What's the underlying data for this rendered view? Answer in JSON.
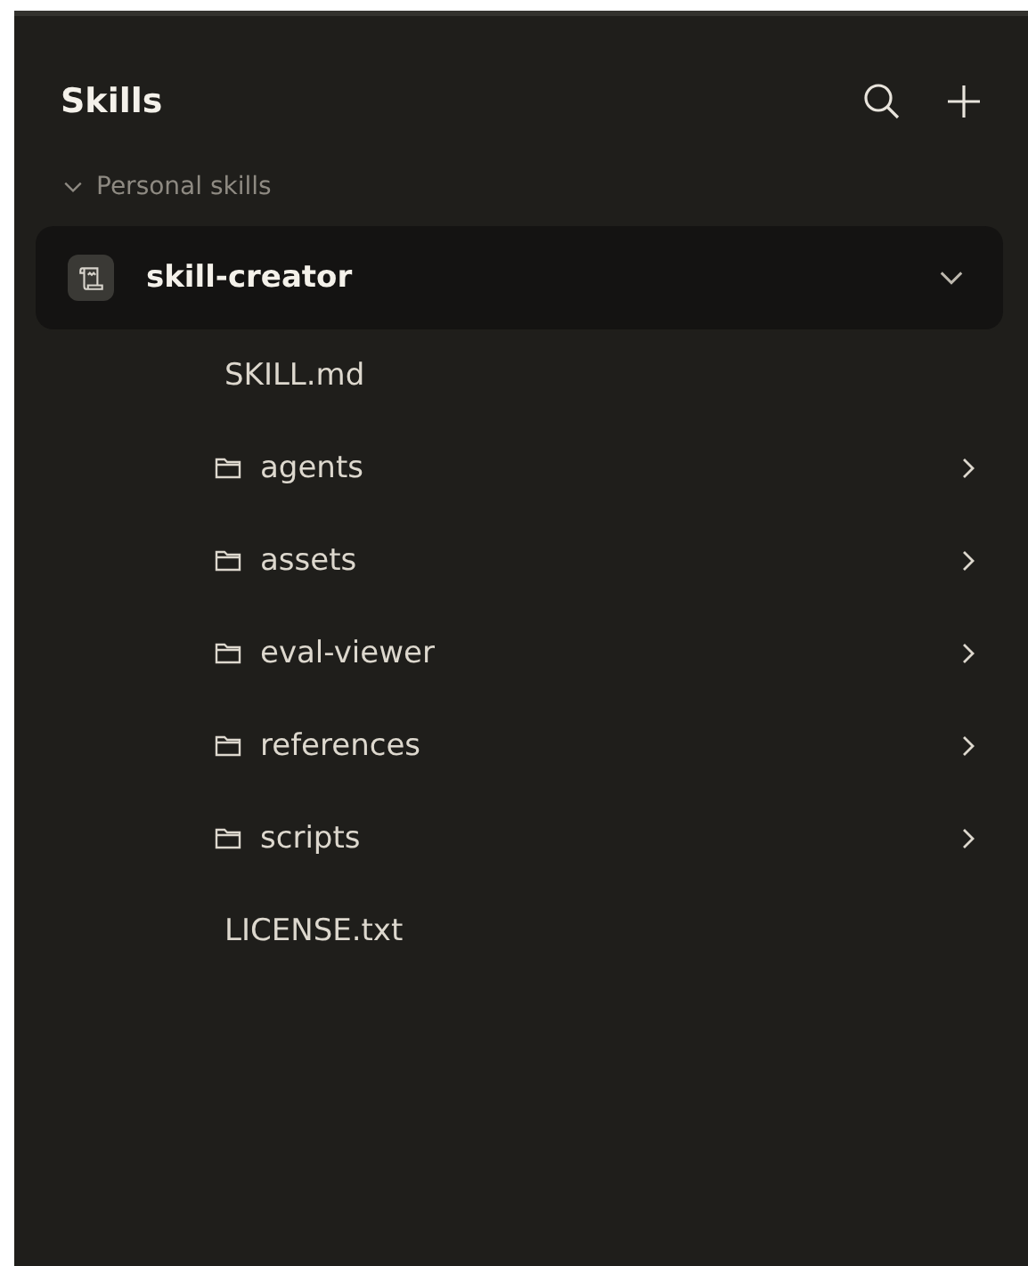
{
  "header": {
    "title": "Skills"
  },
  "section": {
    "label": "Personal skills",
    "expanded": true
  },
  "skills": [
    {
      "name": "skill-creator",
      "selected": true,
      "expanded": true,
      "children": [
        {
          "kind": "file",
          "name": "SKILL.md"
        },
        {
          "kind": "folder",
          "name": "agents",
          "expanded": false
        },
        {
          "kind": "folder",
          "name": "assets",
          "expanded": false
        },
        {
          "kind": "folder",
          "name": "eval-viewer",
          "expanded": false
        },
        {
          "kind": "folder",
          "name": "references",
          "expanded": false
        },
        {
          "kind": "folder",
          "name": "scripts",
          "expanded": false
        },
        {
          "kind": "file",
          "name": "LICENSE.txt"
        }
      ]
    }
  ]
}
